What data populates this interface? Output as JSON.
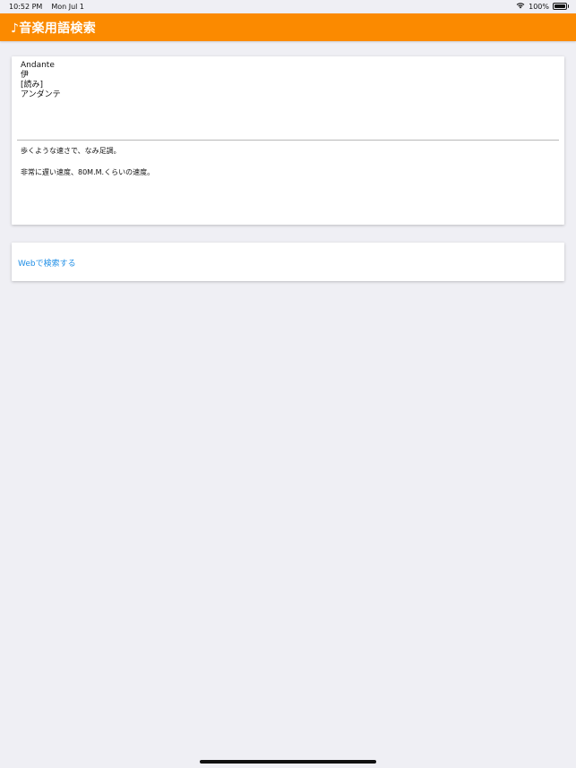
{
  "status_bar": {
    "time": "10:52 PM",
    "date": "Mon Jul 1",
    "battery": "100%",
    "wifi_icon": "wifi-icon",
    "battery_icon": "battery-icon"
  },
  "nav": {
    "title": "♪音楽用語検索",
    "color": "#fb8a00"
  },
  "term": {
    "word": "Andante",
    "language": "伊",
    "reading_label": "[読み]",
    "reading": "アンダンテ",
    "meanings": [
      "歩くような速さで、なみ足調。",
      "非常に遅い速度、80M.M.くらいの速度。"
    ]
  },
  "web_search": {
    "label": "Webで検索する",
    "color": "#1f8ee6"
  }
}
